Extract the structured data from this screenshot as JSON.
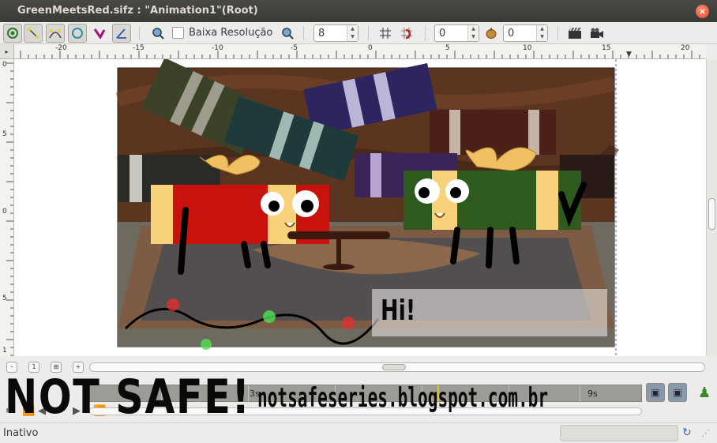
{
  "window": {
    "title": "GreenMeetsRed.sifz : \"Animation1\"(Root)",
    "close_label": "×"
  },
  "toolbar": {
    "low_res_label": "Baixa Resolução",
    "low_res_checked": false,
    "quality_value": "8",
    "onion_past_value": "0",
    "onion_future_value": "0"
  },
  "ruler": {
    "h_labels": [
      "-20",
      "-15",
      "-10",
      "-5",
      "0",
      "5",
      "10",
      "15",
      "20"
    ],
    "v_labels": [
      "0",
      "5",
      "0",
      "5",
      "1"
    ]
  },
  "canvas": {
    "speech_text": "Hi!",
    "colors": {
      "wood": "#5b3520",
      "red_gift": "#c8120e",
      "green_gift": "#2e5a1e",
      "ribbon": "#f0c063"
    }
  },
  "timeline": {
    "labels": [
      "3s",
      "9s"
    ]
  },
  "watermark": {
    "big": "NOT SAFE!",
    "url": "notsafeseries.blogspot.com.br"
  },
  "statusbar": {
    "status_text": "Inativo"
  }
}
